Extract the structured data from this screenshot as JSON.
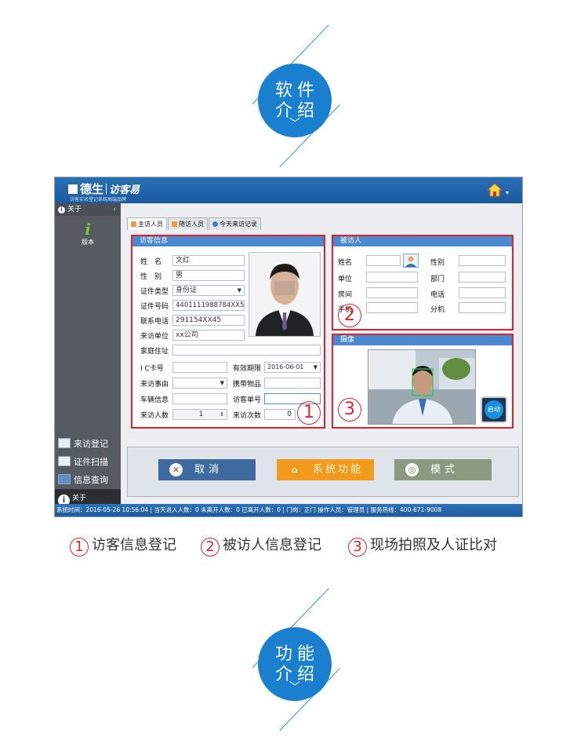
{
  "badges": [
    {
      "line1": "软件",
      "line2": "介绍",
      "chevron": "﹀"
    },
    {
      "line1": "功能",
      "line2": "介绍",
      "chevron": "﹀"
    }
  ],
  "app": {
    "logo_brand": "德生",
    "logo_sub": "访客易",
    "slogan": "访客实名登记系统高端品牌",
    "home_icon": "home-icon",
    "sidebar": {
      "header": "关于",
      "version_label": "版本",
      "version_icon_char": "i",
      "items": [
        {
          "label": "来访登记",
          "icon": "register-icon"
        },
        {
          "label": "证件扫描",
          "icon": "scan-icon"
        },
        {
          "label": "信息查询",
          "icon": "query-icon"
        },
        {
          "label": "关于",
          "icon": "info-icon"
        }
      ]
    },
    "tabs": [
      {
        "label": "主访人员",
        "active": true
      },
      {
        "label": "随访人员",
        "active": false
      },
      {
        "label": "今天来访记录",
        "active": false
      }
    ],
    "visitor_panel": {
      "title": "访客信息",
      "name_label": "姓　名",
      "name_value": "文红",
      "gender_label": "性　别",
      "gender_value": "男",
      "id_type_label": "证件类型",
      "id_type_value": "身份证",
      "id_no_label": "证件号码",
      "id_no_value": "4401111988784XX5",
      "phone_label": "联系电话",
      "phone_value": "291154XX45",
      "unit_label": "来访单位",
      "unit_value": "xx公司",
      "address_label": "家庭住址",
      "address_value": "",
      "ic_label": "I C卡号",
      "ic_value": "",
      "valid_label": "有效期限",
      "valid_value": "2016-06-01",
      "reason_label": "来访事由",
      "reason_value": "",
      "carry_label": "携带物品",
      "carry_value": "",
      "vehicle_label": "车辆信息",
      "vehicle_value": "",
      "visit_no_label": "访客单号",
      "visit_no_value": "",
      "count_label": "来访人数",
      "count_value": "1",
      "times_label": "来访次数",
      "times_value": "0",
      "marker": "1"
    },
    "host_panel": {
      "title": "被访人",
      "name_label": "姓名",
      "gender_label": "性别",
      "unit_label": "单位",
      "dept_label": "部门",
      "room_label": "房间",
      "phone_label": "电话",
      "mobile_label": "手机",
      "ext_label": "分机",
      "marker": "2"
    },
    "camera_panel": {
      "title": "摄像",
      "start_label": "启动",
      "marker": "3"
    },
    "buttons": {
      "cancel": "取消",
      "system": "系统功能",
      "mode": "模式",
      "colors": {
        "cancel": "#3e6aa0",
        "system": "#f29a1c",
        "mode": "#8a9a80"
      }
    },
    "status": "系统时间：2016-05-26 10:56:04 | 当天进入人数：0 未离开人数：0 已离开人数：0 | 门岗：正门 操作人员：管理员 | 服务热线：400-671-9008"
  },
  "captions": [
    {
      "num": "1",
      "text": "访客信息登记"
    },
    {
      "num": "2",
      "text": "被访人信息登记"
    },
    {
      "num": "3",
      "text": "现场拍照及人证比对"
    }
  ],
  "colors": {
    "accent": "#1a7fcf",
    "marker_red": "#e0222a",
    "panel_header": "#4a88cf"
  }
}
